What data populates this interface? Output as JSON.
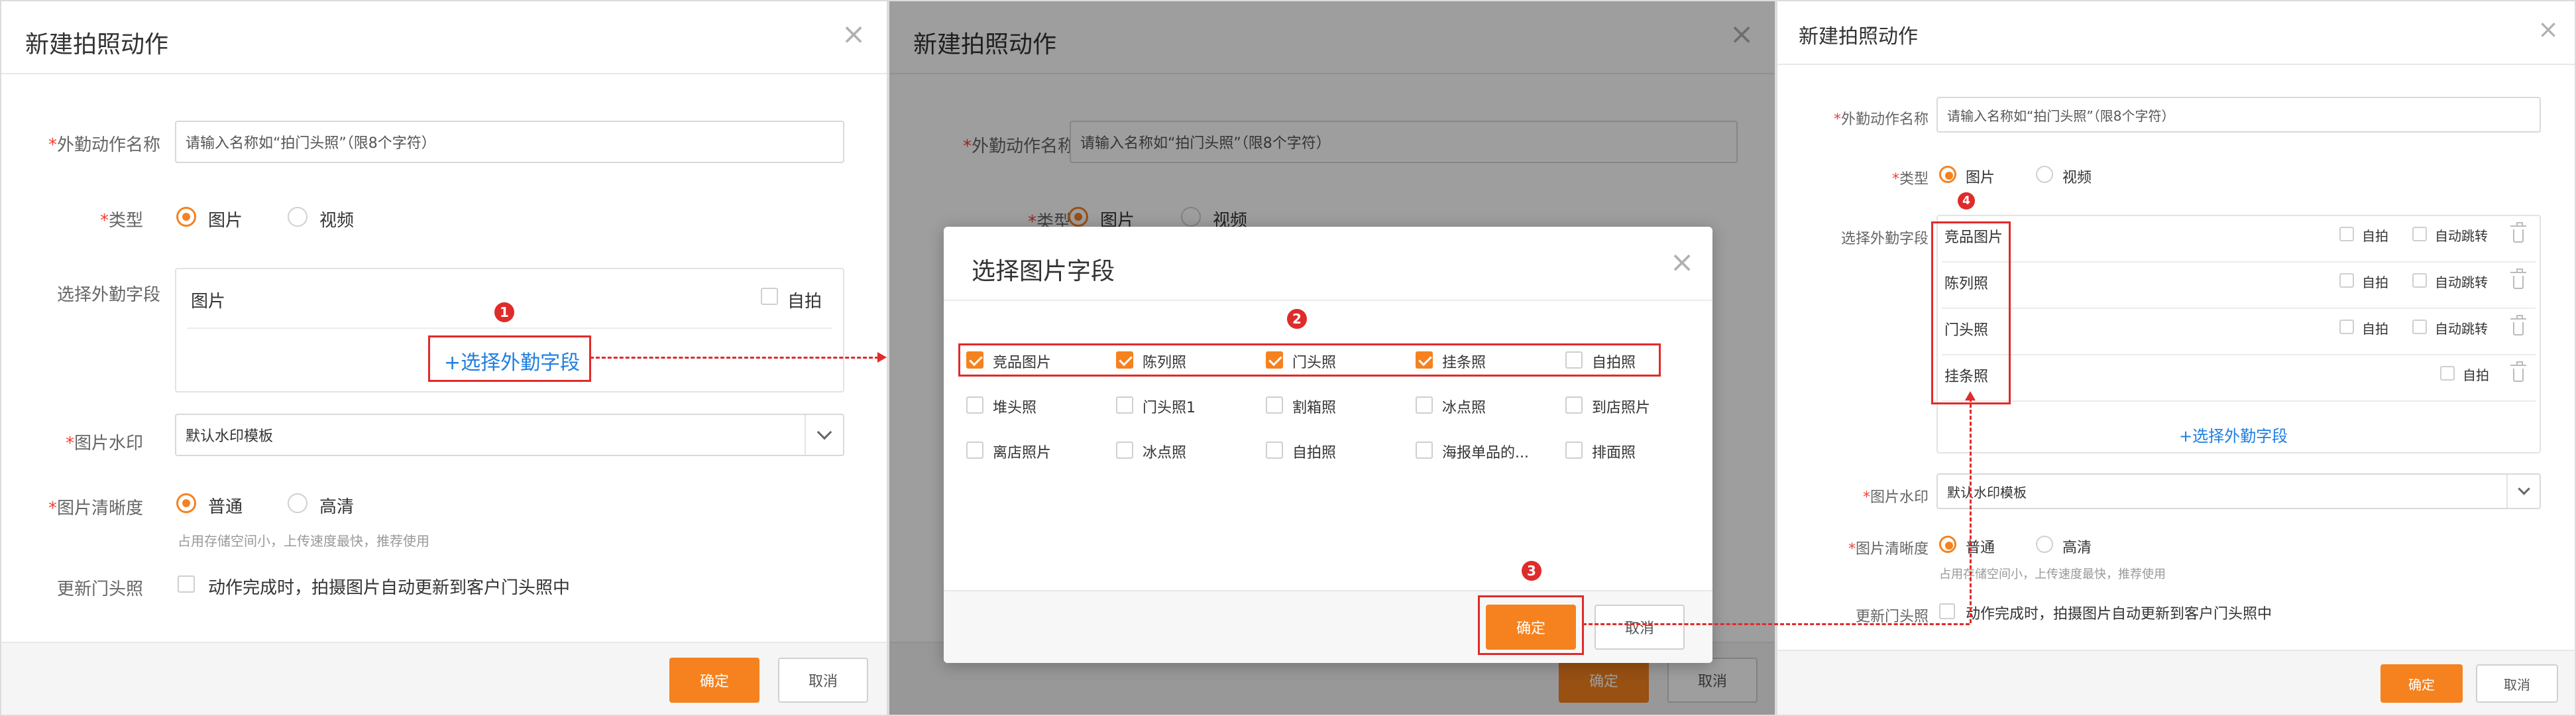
{
  "dialog": {
    "title": "新建拍照动作",
    "name_label": "外勤动作名称",
    "name_placeholder": "请输入名称如“拍门头照”（限8个字符）",
    "type_label": "类型",
    "type_options": [
      "图片",
      "视频"
    ],
    "fields_label": "选择外勤字段",
    "watermark_label": "图片水印",
    "watermark_value": "默认水印模板",
    "clarity_label": "图片清晰度",
    "clarity_options": [
      "普通",
      "高清"
    ],
    "clarity_hint": "占用存储空间小，上传速度最快，推荐使用",
    "update_label": "更新门头照",
    "update_text": "动作完成时，拍摄图片自动更新到客户门头照中",
    "ok": "确定",
    "cancel": "取消",
    "required_mark": "*"
  },
  "panel1": {
    "field_row": "图片",
    "self_shoot": "自拍",
    "select_fields_link": "+选择外勤字段"
  },
  "modal": {
    "title": "选择图片字段",
    "ok": "确定",
    "cancel": "取消",
    "grid": [
      [
        {
          "label": "竞品图片",
          "checked": true
        },
        {
          "label": "陈列照",
          "checked": true
        },
        {
          "label": "门头照",
          "checked": true
        },
        {
          "label": "挂条照",
          "checked": true
        },
        {
          "label": "自拍照",
          "checked": false
        }
      ],
      [
        {
          "label": "堆头照",
          "checked": false
        },
        {
          "label": "门头照1",
          "checked": false
        },
        {
          "label": "割箱照",
          "checked": false
        },
        {
          "label": "冰点照",
          "checked": false
        },
        {
          "label": "到店照片",
          "checked": false
        }
      ],
      [
        {
          "label": "离店照片",
          "checked": false
        },
        {
          "label": "冰点照",
          "checked": false
        },
        {
          "label": "自拍照",
          "checked": false
        },
        {
          "label": "海报单品的...",
          "checked": false
        },
        {
          "label": "排面照",
          "checked": false
        }
      ]
    ]
  },
  "panel3": {
    "rows": [
      {
        "name": "竞品图片",
        "self": "自拍",
        "auto": "自动跳转"
      },
      {
        "name": "陈列照",
        "self": "自拍",
        "auto": "自动跳转"
      },
      {
        "name": "门头照",
        "self": "自拍",
        "auto": "自动跳转"
      },
      {
        "name": "挂条照",
        "self": "自拍",
        "auto": ""
      }
    ],
    "select_fields_link": "+选择外勤字段"
  },
  "steps": [
    "1",
    "2",
    "3",
    "4"
  ],
  "colors": {
    "accent": "#f5821f",
    "annotation": "#e02b2b",
    "link": "#1e7fe0"
  }
}
